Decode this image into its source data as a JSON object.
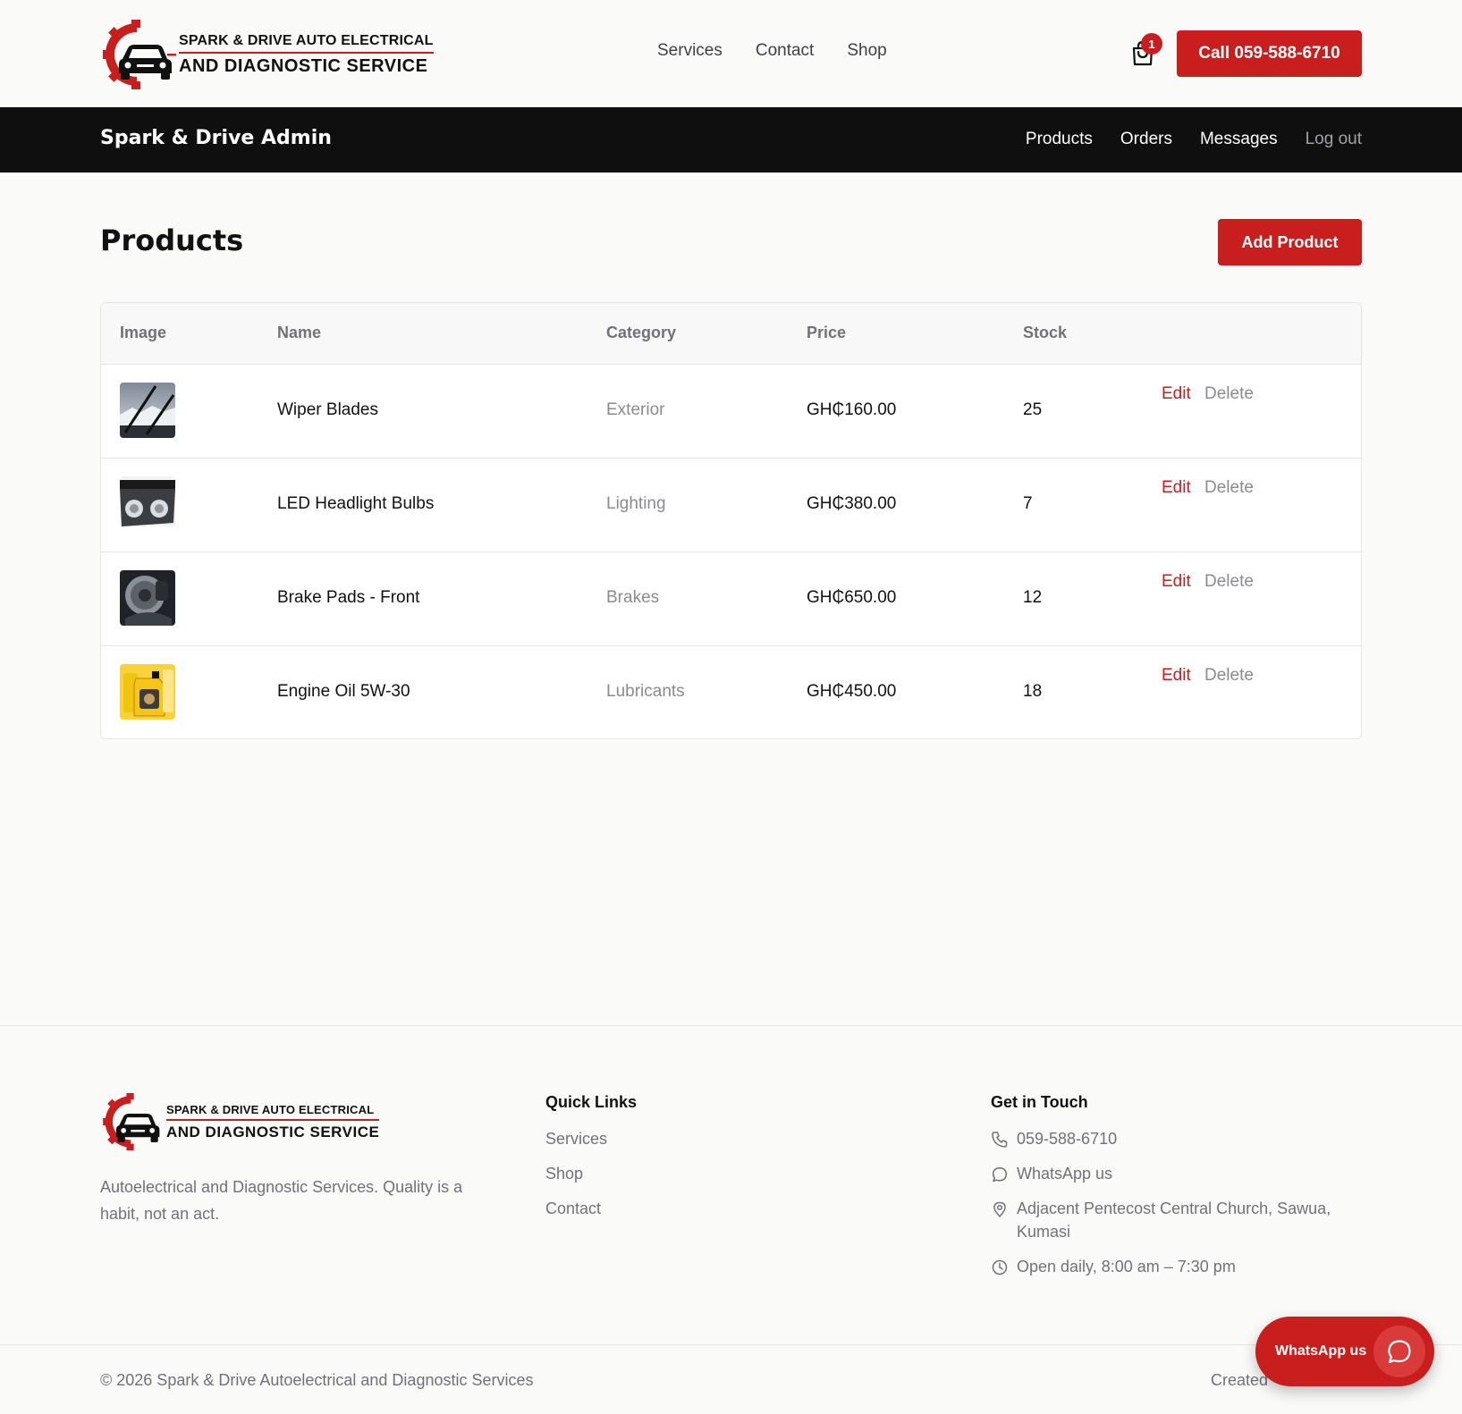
{
  "brand": {
    "logo_line1": "SPARK & DRIVE AUTO ELECTRICAL",
    "logo_line2": "AND DIAGNOSTIC SERVICE",
    "accent_color": "#c81e1e"
  },
  "header": {
    "nav": [
      "Services",
      "Contact",
      "Shop"
    ],
    "cart_count": "1",
    "call_label": "Call 059-588-6710"
  },
  "admin": {
    "brand": "Spark & Drive Admin",
    "nav": [
      "Products",
      "Orders",
      "Messages"
    ],
    "logout": "Log out"
  },
  "products": {
    "title": "Products",
    "add_label": "Add Product",
    "columns": [
      "Image",
      "Name",
      "Category",
      "Price",
      "Stock"
    ],
    "rows": [
      {
        "image": "wiper-blades-photo",
        "name": "Wiper Blades",
        "category": "Exterior",
        "price": "GH₵160.00",
        "stock": "25",
        "edit": "Edit",
        "delete": "Delete"
      },
      {
        "image": "headlight-photo",
        "name": "LED Headlight Bulbs",
        "category": "Lighting",
        "price": "GH₵380.00",
        "stock": "7",
        "edit": "Edit",
        "delete": "Delete"
      },
      {
        "image": "brake-pads-photo",
        "name": "Brake Pads - Front",
        "category": "Brakes",
        "price": "GH₵650.00",
        "stock": "12",
        "edit": "Edit",
        "delete": "Delete"
      },
      {
        "image": "engine-oil-photo",
        "name": "Engine Oil 5W-30",
        "category": "Lubricants",
        "price": "GH₵450.00",
        "stock": "18",
        "edit": "Edit",
        "delete": "Delete"
      }
    ]
  },
  "footer": {
    "tagline": "Autoelectrical and Diagnostic Services. Quality is a habit, not an act.",
    "quick_links_title": "Quick Links",
    "quick_links": [
      "Services",
      "Shop",
      "Contact"
    ],
    "contact_title": "Get in Touch",
    "phone": "059-588-6710",
    "whatsapp": "WhatsApp us",
    "address": "Adjacent Pentecost Central Church, Sawua, Kumasi",
    "hours": "Open daily, 8:00 am – 7:30 pm",
    "copyright": "© 2026 Spark & Drive Autoelectrical and Diagnostic Services",
    "created": "Created"
  },
  "floating": {
    "whatsapp_label": "WhatsApp us"
  }
}
